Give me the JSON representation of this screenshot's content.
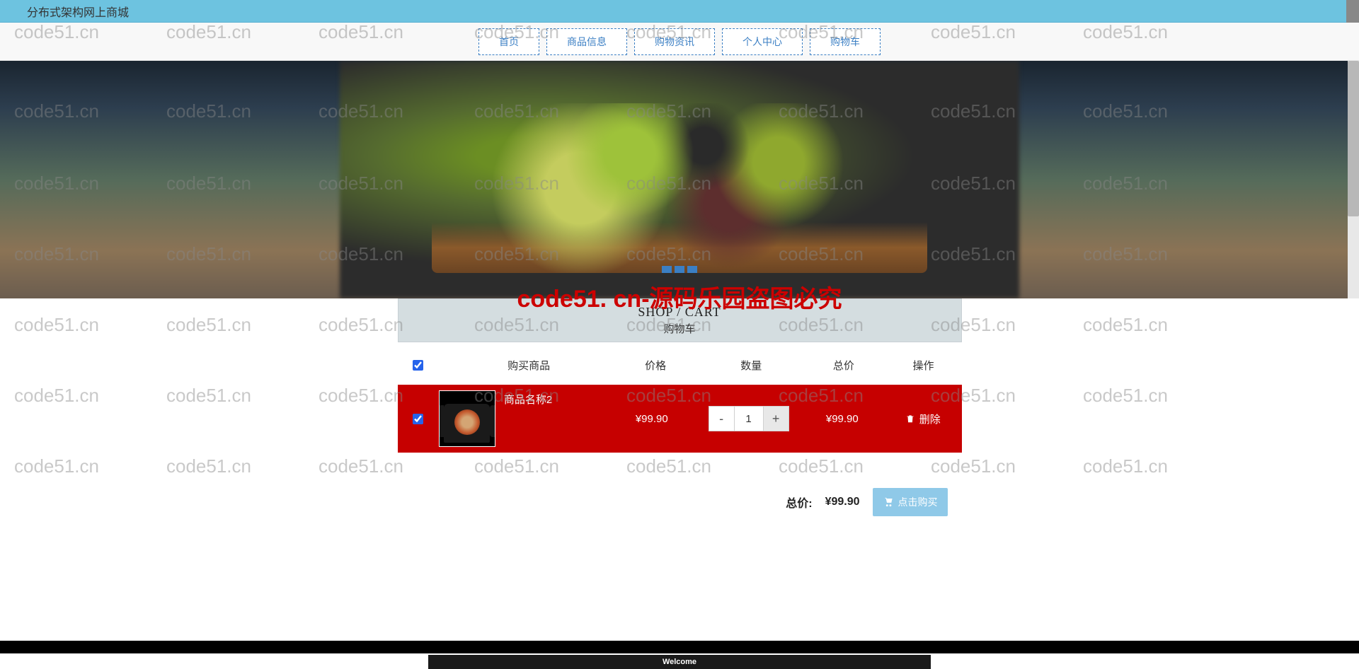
{
  "header": {
    "site_title": "分布式架构网上商城"
  },
  "nav": {
    "items": [
      "首页",
      "商品信息",
      "购物资讯",
      "个人中心",
      "购物车"
    ]
  },
  "cart": {
    "title_en": "SHOP / CART",
    "title_cn": "购物车",
    "columns": {
      "product": "购买商品",
      "price": "价格",
      "qty": "数量",
      "total": "总价",
      "op": "操作"
    },
    "items": [
      {
        "name": "商品名称2",
        "price": "¥99.90",
        "qty": "1",
        "total": "¥99.90",
        "delete_label": "删除",
        "checked": true
      }
    ],
    "select_all_checked": true,
    "summary": {
      "label": "总价:",
      "amount": "¥99.90",
      "buy_label": "点击购买"
    }
  },
  "footer": {
    "welcome": "Welcome"
  },
  "watermark": {
    "text": "code51.cn",
    "center": "code51. cn-源码乐园盗图必究"
  },
  "qty": {
    "minus": "-",
    "plus": "+"
  }
}
